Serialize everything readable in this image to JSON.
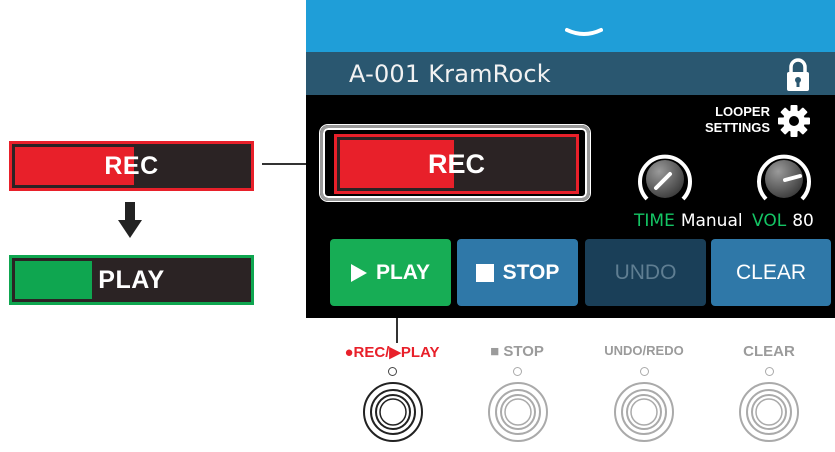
{
  "legend": {
    "rec_label": "REC",
    "play_label": "PLAY",
    "rec_progress": 0.51,
    "play_progress": 0.33
  },
  "screen": {
    "patch_name": "A-001 KramRock",
    "looper_settings_line1": "LOOPER",
    "looper_settings_line2": "SETTINGS",
    "rec_label": "REC",
    "rec_progress": 0.49,
    "time_key": "TIME",
    "time_value": "Manual",
    "vol_key": "VOL",
    "vol_value": "80",
    "buttons": {
      "play": "PLAY",
      "stop": "STOP",
      "undo": "UNDO",
      "clear": "CLEAR"
    }
  },
  "footswitches": {
    "rec_play": "●REC/▶PLAY",
    "stop": "■ STOP",
    "undo_redo": "UNDO/REDO",
    "clear": "CLEAR"
  },
  "colors": {
    "rec_red": "#e8202a",
    "play_green": "#0fa650",
    "top_strip_blue": "#1f9ed8",
    "header_blue": "#2a5770",
    "button_blue": "#2f78a8",
    "knob_green_label": "#14c464"
  },
  "icons": [
    "chevron-down-icon",
    "lock-icon",
    "gear-icon",
    "arrow-down-icon",
    "play-icon",
    "stop-icon",
    "footswitch-icon"
  ]
}
